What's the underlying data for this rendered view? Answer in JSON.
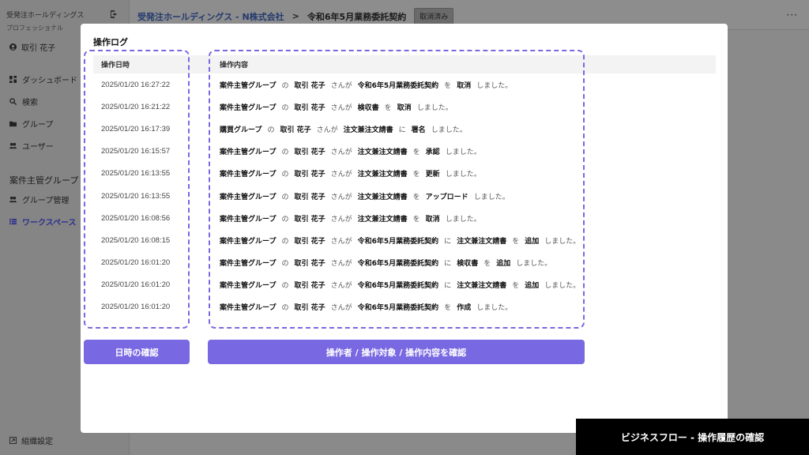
{
  "sidebar": {
    "org_name": "受発注ホールディングス",
    "plan": "プロフェッショナル",
    "user_name": "取引 花子",
    "nav": [
      {
        "label": "ダッシュボード",
        "icon": "dashboard-icon"
      },
      {
        "label": "検索",
        "icon": "search-icon"
      },
      {
        "label": "グループ",
        "icon": "folder-icon"
      },
      {
        "label": "ユーザー",
        "icon": "users-icon"
      }
    ],
    "group_title": "案件主管グループ",
    "group_nav": [
      {
        "label": "グループ管理",
        "icon": "users-icon"
      },
      {
        "label": "ワークスペース",
        "icon": "list-icon"
      }
    ],
    "settings_label": "組織設定"
  },
  "header": {
    "crumb_link": "受発注ホールディングス - N株式会社",
    "crumb_sep": ">",
    "crumb_current": "令和6年5月業務委託契約",
    "badge": "取消済み",
    "more": "···"
  },
  "modal": {
    "title": "操作ログ",
    "col_date": "操作日時",
    "col_content": "操作内容",
    "rows": [
      {
        "date": "2025/01/20 16:27:22",
        "parts": [
          [
            "b",
            "案件主管グループ"
          ],
          [
            "p",
            "の"
          ],
          [
            "b",
            "取引 花子"
          ],
          [
            "p",
            "さんが"
          ],
          [
            "b",
            "令和6年5月業務委託契約"
          ],
          [
            "p",
            "を"
          ],
          [
            "b",
            "取消"
          ],
          [
            "p",
            "しました。"
          ]
        ]
      },
      {
        "date": "2025/01/20 16:21:22",
        "parts": [
          [
            "b",
            "案件主管グループ"
          ],
          [
            "p",
            "の"
          ],
          [
            "b",
            "取引 花子"
          ],
          [
            "p",
            "さんが"
          ],
          [
            "b",
            "検収書"
          ],
          [
            "p",
            "を"
          ],
          [
            "b",
            "取消"
          ],
          [
            "p",
            "しました。"
          ]
        ]
      },
      {
        "date": "2025/01/20 16:17:39",
        "parts": [
          [
            "b",
            "購買グループ"
          ],
          [
            "p",
            "の"
          ],
          [
            "b",
            "取引 花子"
          ],
          [
            "p",
            "さんが"
          ],
          [
            "b",
            "注文兼注文請書"
          ],
          [
            "p",
            "に"
          ],
          [
            "b",
            "署名"
          ],
          [
            "p",
            "しました。"
          ]
        ]
      },
      {
        "date": "2025/01/20 16:15:57",
        "parts": [
          [
            "b",
            "案件主管グループ"
          ],
          [
            "p",
            "の"
          ],
          [
            "b",
            "取引 花子"
          ],
          [
            "p",
            "さんが"
          ],
          [
            "b",
            "注文兼注文請書"
          ],
          [
            "p",
            "を"
          ],
          [
            "b",
            "承認"
          ],
          [
            "p",
            "しました。"
          ]
        ]
      },
      {
        "date": "2025/01/20 16:13:55",
        "parts": [
          [
            "b",
            "案件主管グループ"
          ],
          [
            "p",
            "の"
          ],
          [
            "b",
            "取引 花子"
          ],
          [
            "p",
            "さんが"
          ],
          [
            "b",
            "注文兼注文請書"
          ],
          [
            "p",
            "を"
          ],
          [
            "b",
            "更新"
          ],
          [
            "p",
            "しました。"
          ]
        ]
      },
      {
        "date": "2025/01/20 16:13:55",
        "parts": [
          [
            "b",
            "案件主管グループ"
          ],
          [
            "p",
            "の"
          ],
          [
            "b",
            "取引 花子"
          ],
          [
            "p",
            "さんが"
          ],
          [
            "b",
            "注文兼注文請書"
          ],
          [
            "p",
            "を"
          ],
          [
            "b",
            "アップロード"
          ],
          [
            "p",
            "しました。"
          ]
        ]
      },
      {
        "date": "2025/01/20 16:08:56",
        "parts": [
          [
            "b",
            "案件主管グループ"
          ],
          [
            "p",
            "の"
          ],
          [
            "b",
            "取引 花子"
          ],
          [
            "p",
            "さんが"
          ],
          [
            "b",
            "注文兼注文請書"
          ],
          [
            "p",
            "を"
          ],
          [
            "b",
            "取消"
          ],
          [
            "p",
            "しました。"
          ]
        ]
      },
      {
        "date": "2025/01/20 16:08:15",
        "parts": [
          [
            "b",
            "案件主管グループ"
          ],
          [
            "p",
            "の"
          ],
          [
            "b",
            "取引 花子"
          ],
          [
            "p",
            "さんが"
          ],
          [
            "b",
            "令和6年5月業務委託契約"
          ],
          [
            "p",
            "に"
          ],
          [
            "b",
            "注文兼注文請書"
          ],
          [
            "p",
            "を"
          ],
          [
            "b",
            "追加"
          ],
          [
            "p",
            "しました。"
          ]
        ]
      },
      {
        "date": "2025/01/20 16:01:20",
        "parts": [
          [
            "b",
            "案件主管グループ"
          ],
          [
            "p",
            "の"
          ],
          [
            "b",
            "取引 花子"
          ],
          [
            "p",
            "さんが"
          ],
          [
            "b",
            "令和6年5月業務委託契約"
          ],
          [
            "p",
            "に"
          ],
          [
            "b",
            "検収書"
          ],
          [
            "p",
            "を"
          ],
          [
            "b",
            "追加"
          ],
          [
            "p",
            "しました。"
          ]
        ]
      },
      {
        "date": "2025/01/20 16:01:20",
        "parts": [
          [
            "b",
            "案件主管グループ"
          ],
          [
            "p",
            "の"
          ],
          [
            "b",
            "取引 花子"
          ],
          [
            "p",
            "さんが"
          ],
          [
            "b",
            "令和6年5月業務委託契約"
          ],
          [
            "p",
            "に"
          ],
          [
            "b",
            "注文兼注文請書"
          ],
          [
            "p",
            "を"
          ],
          [
            "b",
            "追加"
          ],
          [
            "p",
            "しました。"
          ]
        ]
      },
      {
        "date": "2025/01/20 16:01:20",
        "parts": [
          [
            "b",
            "案件主管グループ"
          ],
          [
            "p",
            "の"
          ],
          [
            "b",
            "取引 花子"
          ],
          [
            "p",
            "さんが"
          ],
          [
            "b",
            "令和6年5月業務委託契約"
          ],
          [
            "p",
            "を"
          ],
          [
            "b",
            "作成"
          ],
          [
            "p",
            "しました。"
          ]
        ]
      }
    ],
    "btn_date": "日時の確認",
    "btn_content": "操作者 / 操作対象 / 操作内容を確認"
  },
  "caption": "ビジネスフロー - 操作履歴の確認",
  "colors": {
    "accent": "#7868e2",
    "frame": "#7b68e0"
  }
}
